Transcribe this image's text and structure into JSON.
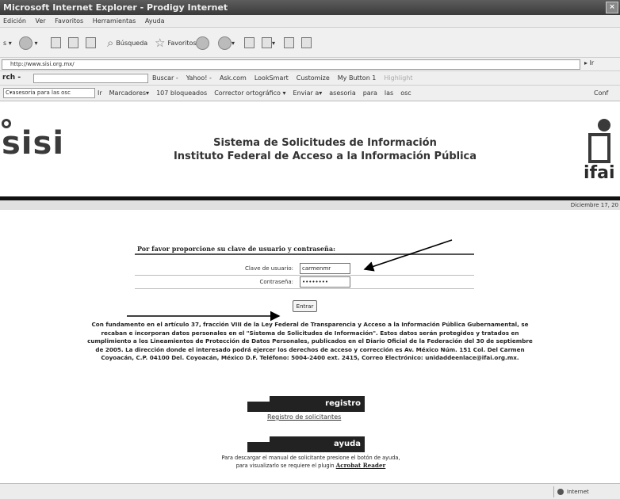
{
  "browser": {
    "title": "Microsoft Internet Explorer - Prodigy Internet",
    "menu": [
      "Edición",
      "Ver",
      "Favoritos",
      "Herramientas",
      "Ayuda"
    ],
    "toolbar": {
      "search": "Búsqueda",
      "favorites": "Favoritos"
    },
    "address": {
      "url": "http://www.sisi.org.mx/",
      "go": "Ir"
    },
    "searchbar": {
      "label": "rch -",
      "items": [
        "Buscar -",
        "Yahoo! -",
        "Ask.com",
        "LookSmart",
        "Customize",
        "My Button 1",
        "Highlight"
      ]
    },
    "linksbar": {
      "field": "C▾asesoria para las osc",
      "go": "Ir",
      "items": [
        "Marcadores▾",
        "107 bloqueados",
        "Corrector ortográfico ▾",
        "Enviar a▾",
        "asesoria",
        "para",
        "las",
        "osc"
      ],
      "trailing": "Conf"
    },
    "status": {
      "zone": "Internet"
    }
  },
  "page": {
    "logo_left": "sisi",
    "logo_right": "ifai",
    "title_line1": "Sistema de Solicitudes de Información",
    "title_line2": "Instituto Federal de Acceso a la Información Pública",
    "date": "Diciembre 17, 20",
    "login": {
      "heading": "Por favor proporcione su clave de usuario y contraseña:",
      "user_label": "Clave de usuario:",
      "user_value": "carmenmr",
      "password_label": "Contraseña:",
      "password_value": "••••••••",
      "submit": "Entrar"
    },
    "legal": "Con fundamento en el artículo 37, fracción VIII de la Ley Federal de Transparencia y Acceso a la Información Pública Gubernamental, se recaban e incorporan datos personales en el \"Sistema de Solicitudes de Información\". Estos datos serán protegidos y tratados en cumplimiento a los Lineamientos de Protección de Datos Personales, publicados en el Diario Oficial de la Federación del 30 de septiembre de 2005. La dirección donde el interesado podrá ejercer los derechos de acceso y corrección es Av. México Núm. 151 Col. Del Carmen Coyoacán, C.P. 04100 Del. Coyoacán, México D.F. Teléfono: 5004-2400 ext. 2415, Correo Electrónico: unidaddeenlace@ifai.org.mx.",
    "registro_button": "registro",
    "registro_link": "Registro de solicitantes",
    "ayuda_button": "ayuda",
    "help_line1": "Para descargar el manual de solicitante presione el botón de ayuda,",
    "help_line2": "para visualizarlo se requiere el plugin",
    "help_link": "Acrobat Reader"
  }
}
